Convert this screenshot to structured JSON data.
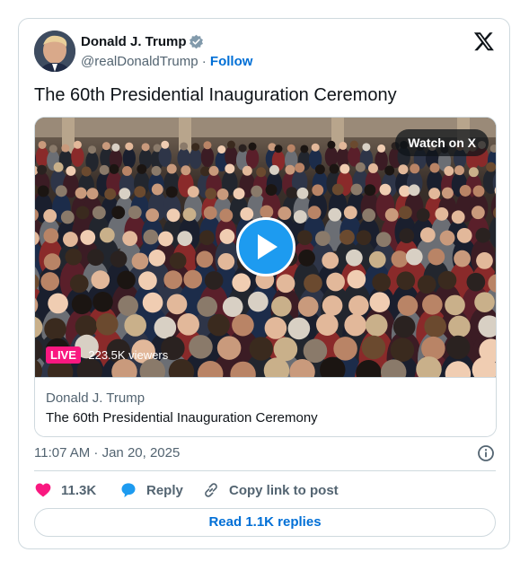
{
  "author": {
    "name": "Donald J. Trump",
    "handle": "@realDonaldTrump",
    "separator": "·",
    "follow_label": "Follow",
    "verified_color": "#829aab"
  },
  "tweet": {
    "text": "The 60th Presidential Inauguration Ceremony",
    "timestamp": "11:07 AM · Jan 20, 2025"
  },
  "media": {
    "watch_label": "Watch on X",
    "live_label": "LIVE",
    "viewers": "223.5K viewers",
    "card_author": "Donald J. Trump",
    "card_title": "The 60th Presidential Inauguration Ceremony",
    "play_color": "#1d9bf0"
  },
  "actions": {
    "likes": "11.3K",
    "reply_label": "Reply",
    "copy_label": "Copy link to post",
    "like_color": "#f91880",
    "reply_color": "#1d9bf0"
  },
  "footer": {
    "replies_label": "Read 1.1K replies"
  },
  "icons": [
    "verified-badge-icon",
    "x-logo-icon",
    "play-icon",
    "info-icon",
    "heart-icon",
    "reply-bubble-icon",
    "link-icon"
  ]
}
